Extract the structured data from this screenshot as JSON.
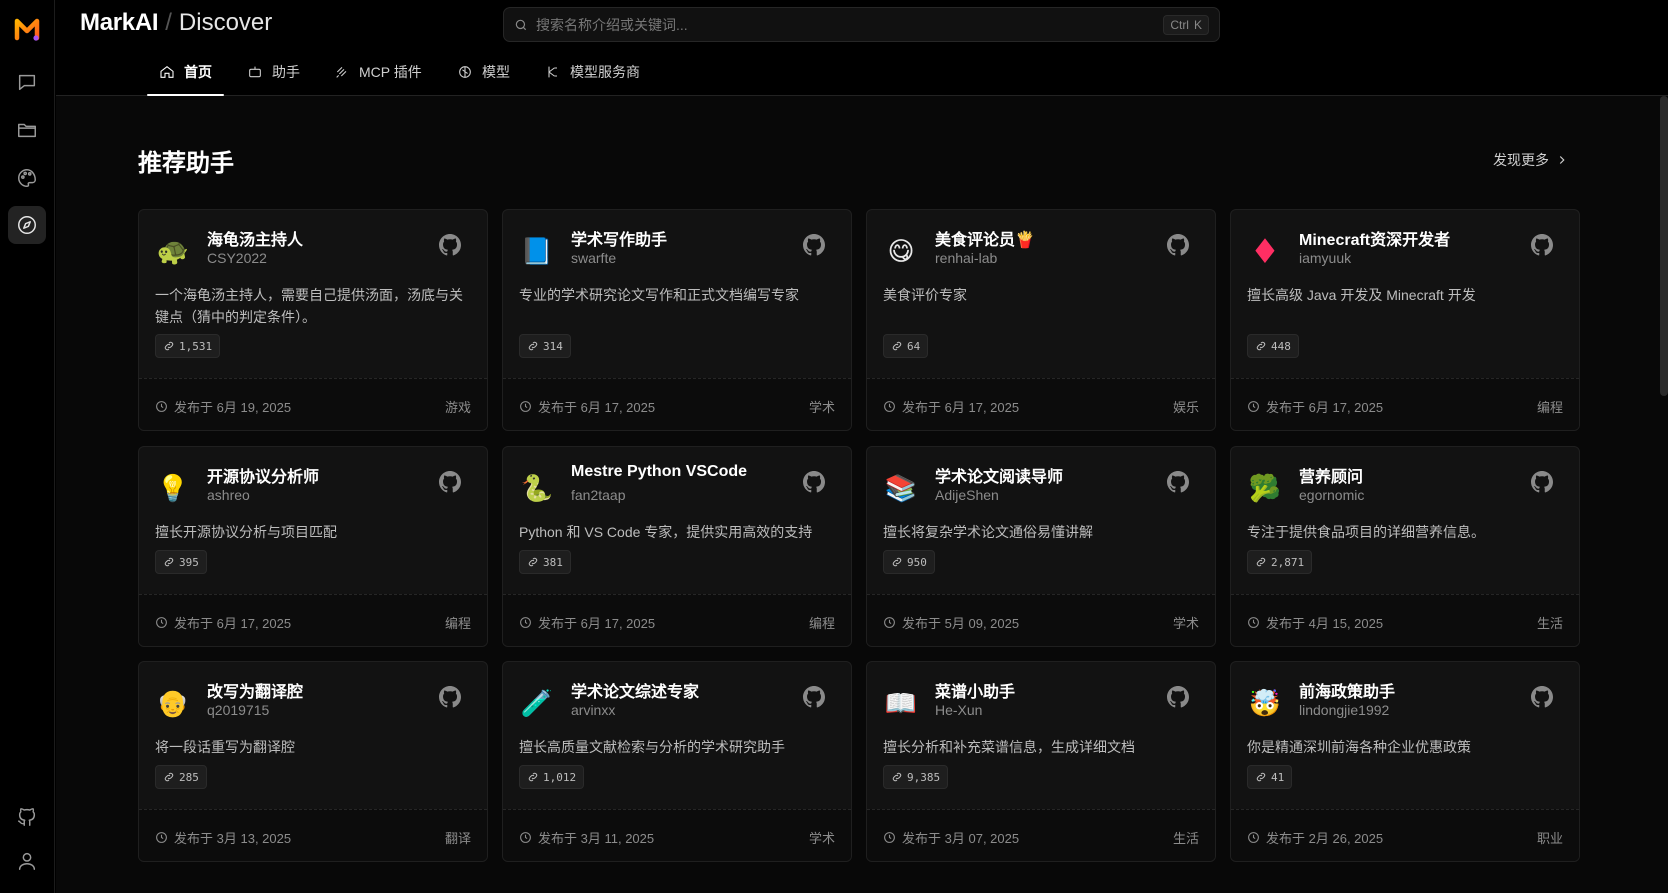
{
  "brand": {
    "name": "MarkAI",
    "section": "Discover"
  },
  "search": {
    "placeholder": "搜索名称介绍或关键词...",
    "shortcut_mod": "Ctrl",
    "shortcut_key": "K"
  },
  "tabs": [
    {
      "label": "首页",
      "icon": "home-icon",
      "active": true
    },
    {
      "label": "助手",
      "icon": "bot-icon"
    },
    {
      "label": "MCP 插件",
      "icon": "plugin-icon"
    },
    {
      "label": "模型",
      "icon": "brain-icon"
    },
    {
      "label": "模型服务商",
      "icon": "provider-icon"
    }
  ],
  "section": {
    "title": "推荐助手",
    "more_label": "发现更多"
  },
  "date_prefix": "发布于",
  "cards": [
    {
      "avatar": "🐢",
      "title": "海龟汤主持人",
      "author": "CSY2022",
      "desc": "一个海龟汤主持人，需要自己提供汤面，汤底与关键点（猜中的判定条件）。",
      "count": "1,531",
      "date": "6月 19, 2025",
      "tag": "游戏"
    },
    {
      "avatar": "📘",
      "title": "学术写作助手",
      "author": "swarfte",
      "desc": "专业的学术研究论文写作和正式文档编写专家",
      "count": "314",
      "date": "6月 17, 2025",
      "tag": "学术"
    },
    {
      "avatar": "😋",
      "title": "美食评论员🍟",
      "author": "renhai-lab",
      "desc": "美食评价专家",
      "count": "64",
      "date": "6月 17, 2025",
      "tag": "娱乐"
    },
    {
      "avatar": "♦",
      "title": "Minecraft资深开发者",
      "author": "iamyuuk",
      "desc": "擅长高级 Java 开发及 Minecraft 开发",
      "count": "448",
      "date": "6月 17, 2025",
      "tag": "编程"
    },
    {
      "avatar": "💡",
      "title": "开源协议分析师",
      "author": "ashreo",
      "desc": "擅长开源协议分析与项目匹配",
      "count": "395",
      "date": "6月 17, 2025",
      "tag": "编程"
    },
    {
      "avatar": "🐍",
      "title": "Mestre Python VSCode",
      "author": "fan2taap",
      "desc": "Python 和 VS Code 专家，提供实用高效的支持",
      "count": "381",
      "date": "6月 17, 2025",
      "tag": "编程"
    },
    {
      "avatar": "📚",
      "title": "学术论文阅读导师",
      "author": "AdijeShen",
      "desc": "擅长将复杂学术论文通俗易懂讲解",
      "count": "950",
      "date": "5月 09, 2025",
      "tag": "学术"
    },
    {
      "avatar": "🥦",
      "title": "营养顾问",
      "author": "egornomic",
      "desc": "专注于提供食品项目的详细营养信息。",
      "count": "2,871",
      "date": "4月 15, 2025",
      "tag": "生活"
    },
    {
      "avatar": "👴",
      "title": "改写为翻译腔",
      "author": "q2019715",
      "desc": "将一段话重写为翻译腔",
      "count": "285",
      "date": "3月 13, 2025",
      "tag": "翻译"
    },
    {
      "avatar": "🧪",
      "title": "学术论文综述专家",
      "author": "arvinxx",
      "desc": "擅长高质量文献检索与分析的学术研究助手",
      "count": "1,012",
      "date": "3月 11, 2025",
      "tag": "学术"
    },
    {
      "avatar": "📖",
      "title": "菜谱小助手",
      "author": "He-Xun",
      "desc": "擅长分析和补充菜谱信息，生成详细文档",
      "count": "9,385",
      "date": "3月 07, 2025",
      "tag": "生活"
    },
    {
      "avatar": "🤯",
      "title": "前海政策助手",
      "author": "lindongjie1992",
      "desc": "你是精通深圳前海各种企业优惠政策",
      "count": "41",
      "date": "2月 26, 2025",
      "tag": "职业"
    }
  ]
}
